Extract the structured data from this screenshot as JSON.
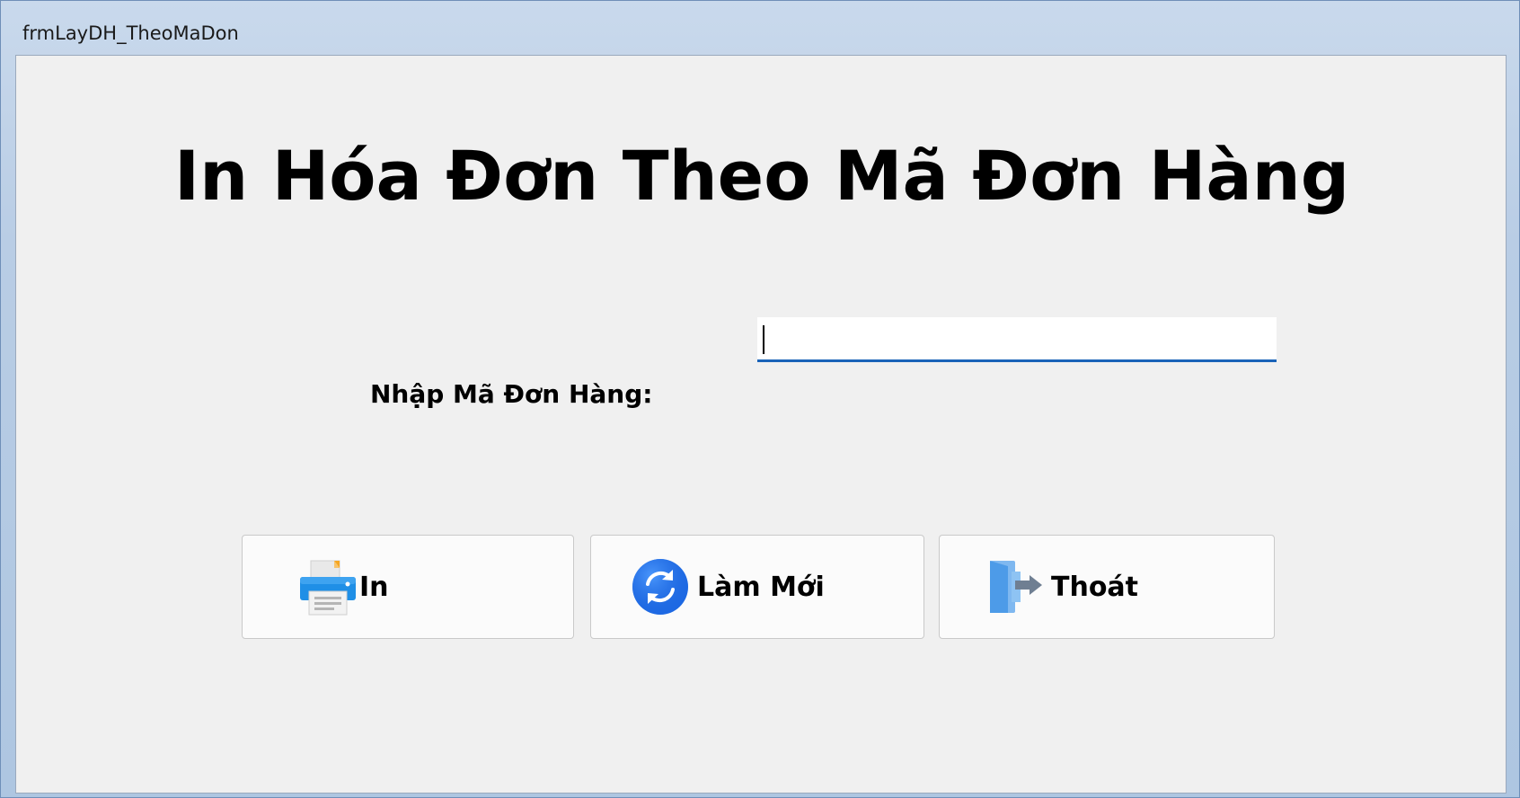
{
  "window": {
    "title": "frmLayDH_TheoMaDon"
  },
  "main": {
    "heading": "In Hóa Đơn Theo Mã Đơn Hàng",
    "order_label": "Nhập Mã Đơn Hàng:",
    "order_input_value": ""
  },
  "buttons": {
    "print": {
      "label": "In",
      "icon": "printer-icon"
    },
    "refresh": {
      "label": "Làm Mới",
      "icon": "refresh-icon"
    },
    "exit": {
      "label": "Thoát",
      "icon": "exit-door-icon"
    }
  },
  "colors": {
    "input_focus_underline": "#1a63b8",
    "refresh_icon_blue": "#1e6be6",
    "exit_door_blue": "#4d9be8",
    "printer_blue": "#1f8fe6"
  }
}
